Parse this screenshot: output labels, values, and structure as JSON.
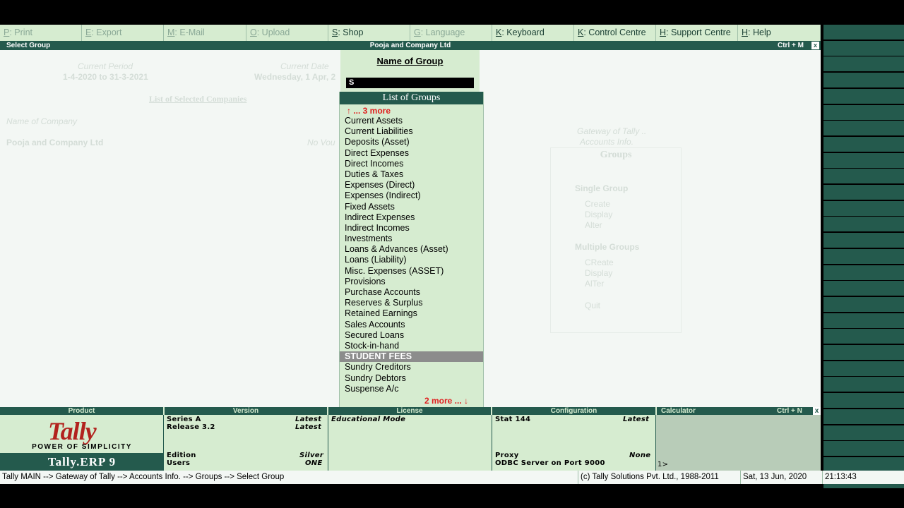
{
  "menu": [
    {
      "key": "P",
      "label": ": Print",
      "enabled": false
    },
    {
      "key": "E",
      "label": ": Export",
      "enabled": false
    },
    {
      "key": "M",
      "label": ": E-Mail",
      "enabled": false
    },
    {
      "key": "O",
      "label": ": Upload",
      "enabled": false
    },
    {
      "key": "S",
      "label": ": Shop",
      "enabled": true
    },
    {
      "key": "G",
      "label": ": Language",
      "enabled": false
    },
    {
      "key": "K",
      "label": ": Keyboard",
      "enabled": true
    },
    {
      "key": "K",
      "label": ": Control Centre",
      "enabled": true
    },
    {
      "key": "H",
      "label": ": Support Centre",
      "enabled": true
    },
    {
      "key": "H",
      "label": ": Help",
      "enabled": true
    }
  ],
  "titlebar": {
    "left": "Select Group",
    "center": "Pooja and Company Ltd",
    "shortcut": "Ctrl + M",
    "close": "x"
  },
  "background": {
    "current_period_label": "Current Period",
    "current_period_value": "1-4-2020 to 31-3-2021",
    "current_date_label": "Current Date",
    "current_date_value": "Wednesday, 1 Apr, 2",
    "list_companies": "List of Selected Companies",
    "name_of_company_label": "Name of Company",
    "company_name": "Pooja and Company Ltd",
    "no_vouchers": "No Vou",
    "gateway_label": "Gateway of Tally ..",
    "accounts_info": "Accounts Info.",
    "groups_title": "Groups",
    "single_group": "Single Group",
    "single_items": [
      "Create",
      "Display",
      "Alter"
    ],
    "multiple_groups": "Multiple Groups",
    "multiple_items": [
      "CReate",
      "Display",
      "AlTer"
    ],
    "quit": "Quit"
  },
  "name_panel": {
    "label": "Name of Group",
    "input_value": "S"
  },
  "list": {
    "title": "List of Groups",
    "more_up": "↑ ... 3 more",
    "more_down": "2 more ... ↓",
    "items": [
      "Current Assets",
      "Current Liabilities",
      "Deposits (Asset)",
      "Direct Expenses",
      "Direct Incomes",
      "Duties & Taxes",
      "Expenses (Direct)",
      "Expenses (Indirect)",
      "Fixed Assets",
      "Indirect Expenses",
      "Indirect Incomes",
      "Investments",
      "Loans & Advances (Asset)",
      "Loans (Liability)",
      "Misc. Expenses (ASSET)",
      "Provisions",
      "Purchase Accounts",
      "Reserves & Surplus",
      "Retained Earnings",
      "Sales Accounts",
      "Secured Loans",
      "Stock-in-hand",
      "STUDENT FEES",
      "Sundry Creditors",
      "Sundry Debtors",
      "Suspense A/c"
    ],
    "selected": "STUDENT FEES"
  },
  "info": {
    "headers": {
      "product": "Product",
      "version": "Version",
      "license": "License",
      "configuration": "Configuration",
      "calculator": "Calculator",
      "calc_shortcut": "Ctrl + N",
      "close": "x"
    },
    "logo": "Tally",
    "tagline": "POWER OF SIMPLICITY",
    "product_name": "Tally.ERP 9",
    "series_label": "Series A",
    "series_value": "Latest",
    "release_label": "Release 3.2",
    "release_value": "Latest",
    "edition_label": "Edition",
    "edition_value": "Silver",
    "users_label": "Users",
    "users_value": "ONE",
    "license_mode": "Educational Mode",
    "stat_label": "Stat  144",
    "stat_value": "Latest",
    "proxy_label": "Proxy",
    "proxy_value": "None",
    "odbc": "ODBC Server on Port 9000",
    "calc_prompt": "1>"
  },
  "status": {
    "path": "Tally MAIN --> Gateway of Tally --> Accounts Info. --> Groups --> Select Group",
    "copyright": "(c) Tally Solutions Pvt. Ltd., 1988-2011",
    "date": "Sat, 13 Jun, 2020",
    "time": "21:13:43"
  }
}
